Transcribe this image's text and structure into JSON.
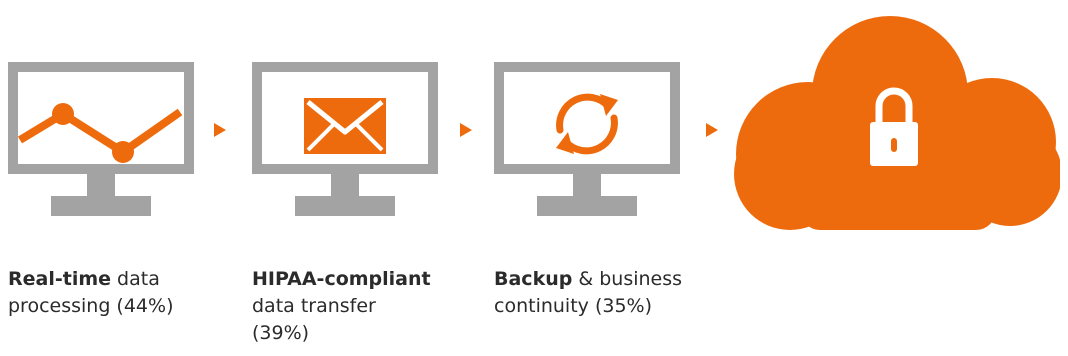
{
  "header": {
    "title_fragment": ""
  },
  "steps": [
    {
      "bold": "Real-time",
      "rest": " data processing (44%)",
      "icon": "line-chart-icon"
    },
    {
      "bold": "HIPAA-compliant",
      "rest": " data transfer (39%)",
      "icon": "envelope-icon"
    },
    {
      "bold": "Backup",
      "rest": " & business continuity (35%)",
      "icon": "sync-arrows-icon"
    }
  ],
  "destination": {
    "icon": "cloud-lock-icon"
  },
  "colors": {
    "accent": "#EE6B0D",
    "monitor": "#A3A3A3",
    "text": "#2B2B2B"
  }
}
